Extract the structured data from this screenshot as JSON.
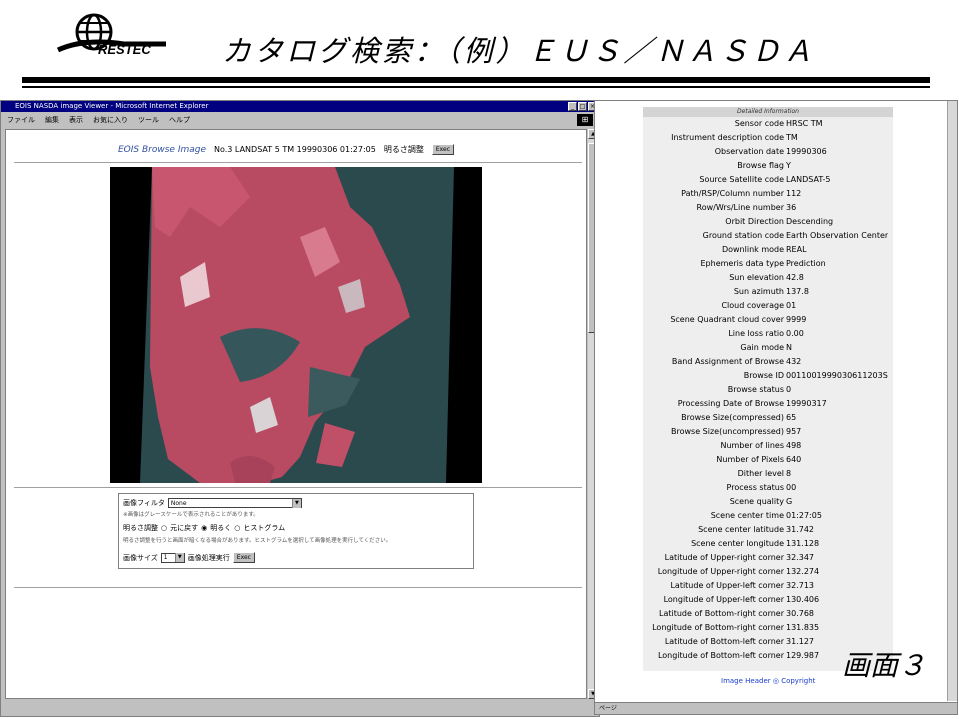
{
  "slide": {
    "logo_text": "RESTEC",
    "title": "カタログ検索：（例）ＥＵＳ／ＮＡＳＤＡ",
    "screen_label": "画面３"
  },
  "browser": {
    "window_title": "EOIS NASDA image Viewer - Microsoft Internet Explorer",
    "menu": [
      "ファイル",
      "編集",
      "表示",
      "お気に入り",
      "ツール",
      "ヘルプ"
    ],
    "page_title": "EOIS Browse Image",
    "scene_info": "No.3 LANDSAT 5 TM 19990306 01:27:05",
    "brightness_label": "明るさ調整",
    "exec_label": "Exec",
    "image_name": "landsat-browse-image",
    "controls": {
      "filter_label": "画像フィルタ",
      "filter_value": "None",
      "filter_note": "※画像はグレースケールで表示されることがあります。",
      "adjust_label": "明るさ調整",
      "adjust_options": [
        "元に戻す",
        "明るく",
        "ヒストグラム"
      ],
      "adjust_note": "明るさ調整を行うと画面が暗くなる場合があります。ヒストグラムを選択して画像処理を実行してください。",
      "size_label": "画像サイズ",
      "size_value": "1",
      "process_label": "画像処理実行",
      "process_exec": "Exec"
    }
  },
  "metadata": {
    "header": "Detailed Information",
    "rows": [
      {
        "label": "Sensor code",
        "value": "HRSC TM"
      },
      {
        "label": "Instrument description code",
        "value": "TM"
      },
      {
        "label": "Observation date",
        "value": "19990306"
      },
      {
        "label": "Browse flag",
        "value": "Y"
      },
      {
        "label": "Source Satellite code",
        "value": "LANDSAT-5"
      },
      {
        "label": "Path/RSP/Column number",
        "value": "112"
      },
      {
        "label": "Row/Wrs/Line number",
        "value": "36"
      },
      {
        "label": "Orbit Direction",
        "value": "Descending"
      },
      {
        "label": "Ground station code",
        "value": "Earth Observation Center"
      },
      {
        "label": "Downlink mode",
        "value": "REAL"
      },
      {
        "label": "Ephemeris data type",
        "value": "Prediction"
      },
      {
        "label": "Sun elevation",
        "value": "42.8"
      },
      {
        "label": "Sun azimuth",
        "value": "137.8"
      },
      {
        "label": "Cloud coverage",
        "value": "01"
      },
      {
        "label": "Scene Quadrant cloud cover",
        "value": "9999"
      },
      {
        "label": "Line loss ratio",
        "value": "0.00"
      },
      {
        "label": "Gain mode",
        "value": "N"
      },
      {
        "label": "Band Assignment of Browse",
        "value": "432"
      },
      {
        "label": "Browse ID",
        "value": "0011001999030611203S"
      },
      {
        "label": "Browse status",
        "value": "0"
      },
      {
        "label": "Processing Date of Browse",
        "value": "19990317"
      },
      {
        "label": "Browse Size(compressed)",
        "value": "65"
      },
      {
        "label": "Browse Size(uncompressed)",
        "value": "957"
      },
      {
        "label": "Number of lines",
        "value": "498"
      },
      {
        "label": "Number of Pixels",
        "value": "640"
      },
      {
        "label": "Dither level",
        "value": "8"
      },
      {
        "label": "Process status",
        "value": "00"
      },
      {
        "label": "Scene quality",
        "value": "G"
      },
      {
        "label": "Scene center time",
        "value": "01:27:05"
      },
      {
        "label": "Scene center latitude",
        "value": "31.742"
      },
      {
        "label": "Scene center longitude",
        "value": "131.128"
      },
      {
        "label": "Latitude of Upper-right corner",
        "value": "32.347"
      },
      {
        "label": "Longitude of Upper-right corner",
        "value": "132.274"
      },
      {
        "label": "Latitude of Upper-left corner",
        "value": "32.713"
      },
      {
        "label": "Longitude of Upper-left corner",
        "value": "130.406"
      },
      {
        "label": "Latitude of Bottom-right corner",
        "value": "30.768"
      },
      {
        "label": "Longitude of Bottom-right corner",
        "value": "131.835"
      },
      {
        "label": "Latitude of Bottom-left corner",
        "value": "31.127"
      },
      {
        "label": "Longitude of Bottom-left corner",
        "value": "129.987"
      }
    ],
    "footer": "Image Header ◎ Copyright"
  },
  "status_bar": "ページ"
}
